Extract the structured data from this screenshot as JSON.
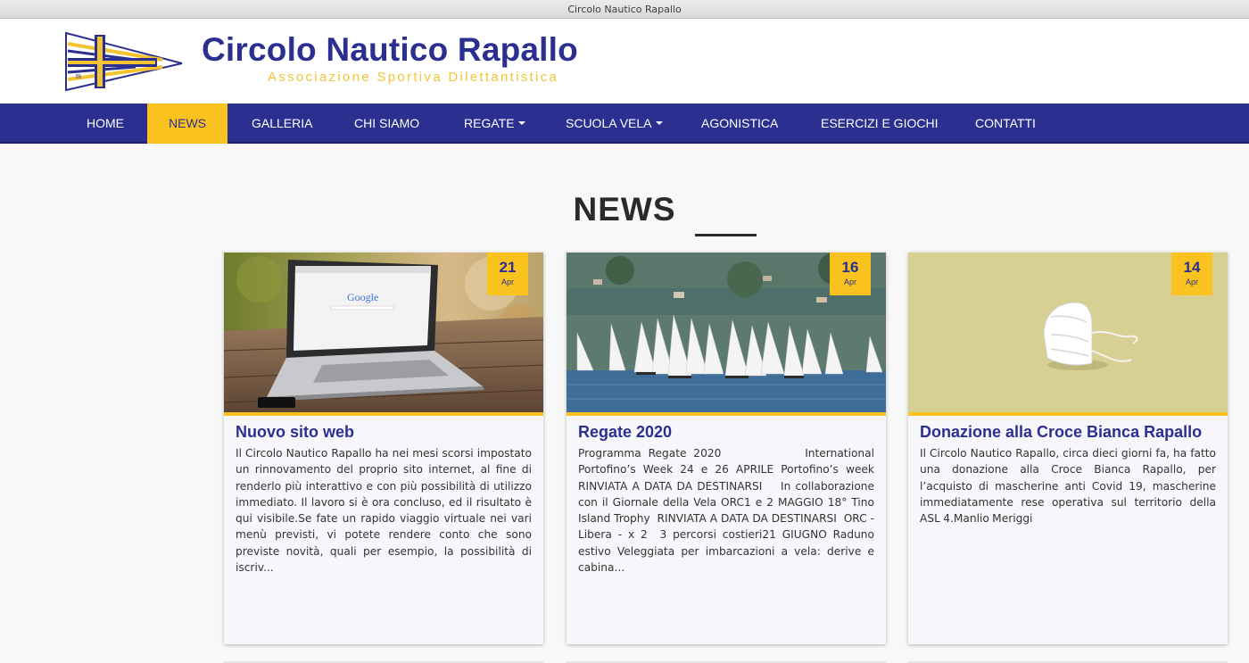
{
  "window": {
    "title": "Circolo Nautico Rapallo"
  },
  "brand": {
    "title": "Circolo Nautico Rapallo",
    "subtitle": "Associazione Sportiva Dilettantistica",
    "logo_text": "fR",
    "colors": {
      "primary": "#2b2f8f",
      "accent": "#f9c21e"
    }
  },
  "nav": {
    "items": [
      {
        "label": "HOME",
        "active": false
      },
      {
        "label": "NEWS",
        "active": true
      },
      {
        "label": "GALLERIA",
        "active": false
      },
      {
        "label": "CHI SIAMO",
        "active": false
      },
      {
        "label": "REGATE",
        "active": false,
        "dropdown": true
      },
      {
        "label": "SCUOLA VELA",
        "active": false,
        "dropdown": true
      },
      {
        "label": "AGONISTICA",
        "active": false
      },
      {
        "label": "ESERCIZI E GIOCHI",
        "active": false
      },
      {
        "label": "CONTATTI",
        "active": false
      }
    ]
  },
  "section": {
    "title": "NEWS"
  },
  "news": [
    {
      "day": "21",
      "month": "Apr",
      "title": "Nuovo sito web",
      "image": "laptop-google-photo",
      "image_text": "Google",
      "text": "Il Circolo Nautico Rapallo ha nei mesi scorsi impostato un rinnovamento del proprio sito internet, al fine di renderlo più interattivo e con più possibilità di utilizzo immediato. Il lavoro si è ora concluso, ed il risultato è qui visibile.Se fate un rapido viaggio virtuale nei vari menù previsti, vi potete rendere conto che sono previste novità, quali per esempio, la possibilità di iscriv..."
    },
    {
      "day": "16",
      "month": "Apr",
      "title": "Regate 2020",
      "image": "sailboats-regatta-photo",
      "text": "Programma Regate 2020            International Portofino’s Week 24 e 26 APRILE Portofino’s week          RINVIATA A DATA DA DESTINARSI    In collaborazione con il Giornale della Vela ORC1 e 2 MAGGIO 18° Tino Island Trophy  RINVIATA A DATA DA DESTINARSI  ORC - Libera - x 2  3 percorsi costieri21 GIUGNO Raduno estivo Veleggiata per imbarcazioni a vela: derive e cabina..."
    },
    {
      "day": "14",
      "month": "Apr",
      "title": "Donazione alla Croce Bianca Rapallo",
      "image": "face-mask-photo",
      "text": "Il Circolo Nautico Rapallo, circa dieci giorni fa, ha fatto una donazione alla Croce Bianca Rapallo, per l’acquisto di mascherine anti Covid 19, mascherine immediatamente rese operativa sul territorio della ASL 4.Manlio Meriggi"
    }
  ]
}
